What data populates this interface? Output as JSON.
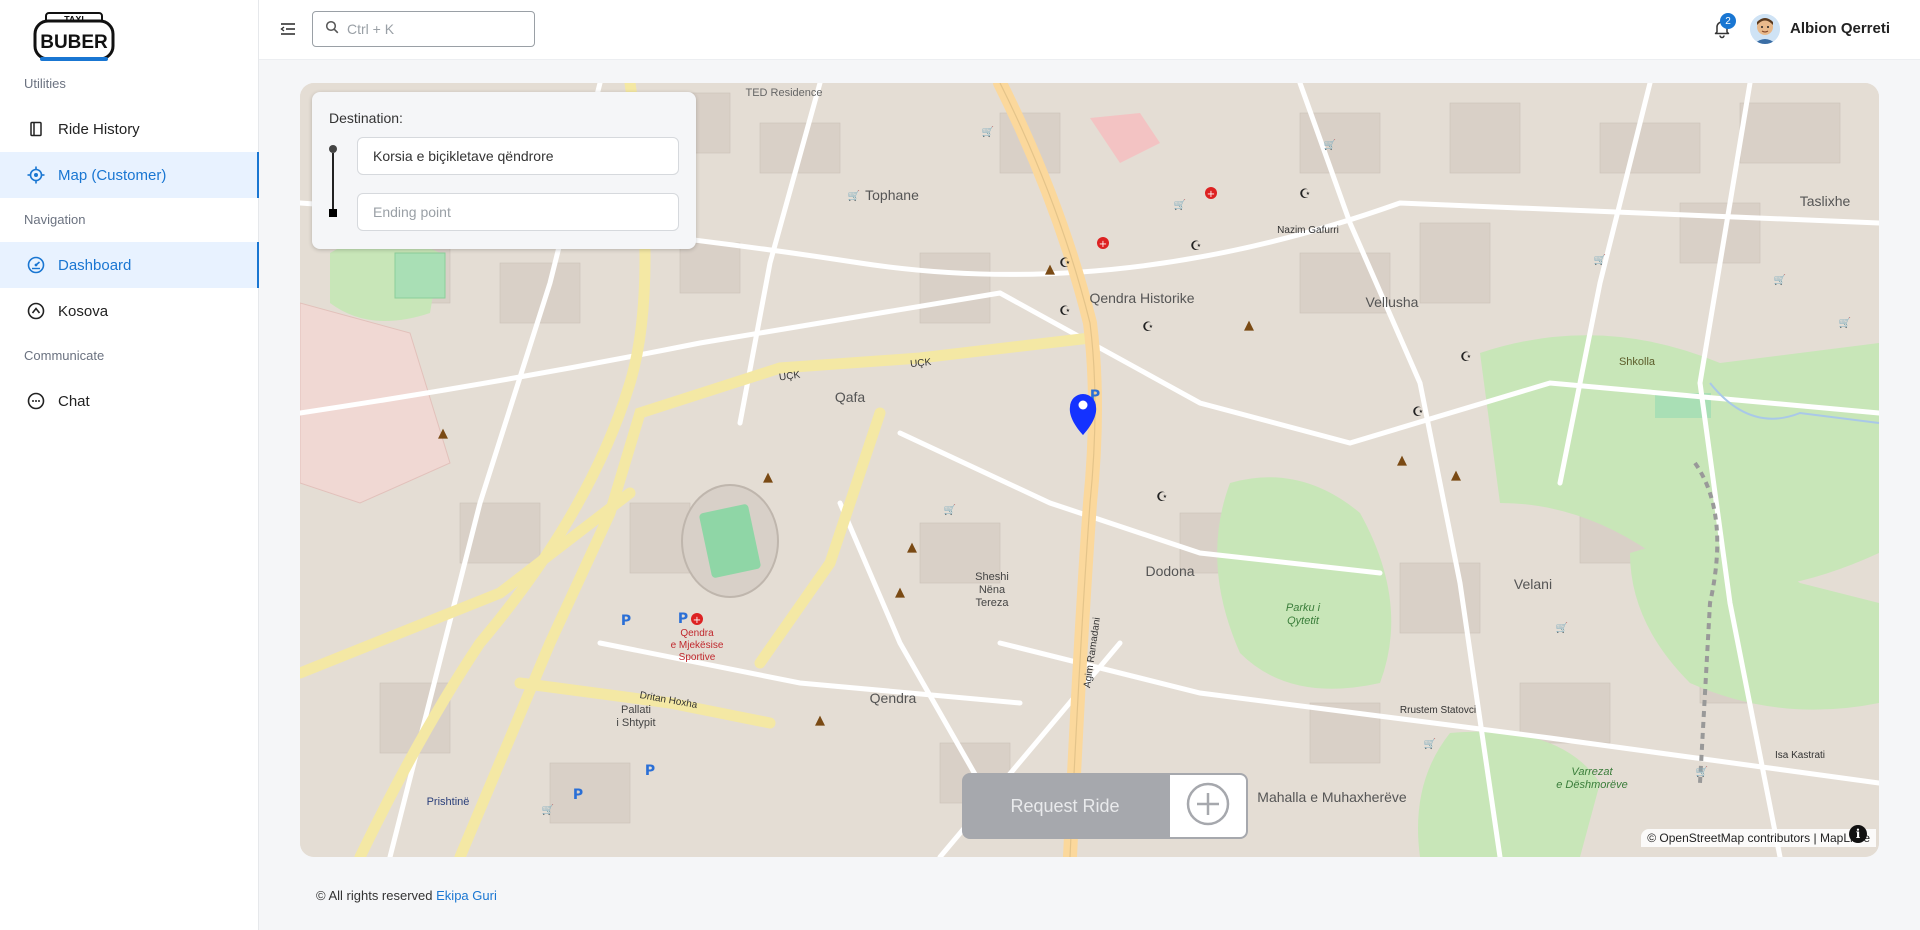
{
  "app": {
    "logo_top": "TAXI",
    "logo_main": "BUBER"
  },
  "sidebar": {
    "groups": [
      {
        "label": "Utilities"
      },
      {
        "label": "Navigation"
      },
      {
        "label": "Communicate"
      }
    ],
    "items": [
      {
        "label": "Ride History",
        "icon": "book-icon",
        "active": false
      },
      {
        "label": "Map (Customer)",
        "icon": "locate-icon",
        "active": true
      },
      {
        "label": "Dashboard",
        "icon": "dashboard-icon",
        "active": true
      },
      {
        "label": "Kosova",
        "icon": "compass-icon",
        "active": false
      },
      {
        "label": "Chat",
        "icon": "chat-icon",
        "active": false
      }
    ]
  },
  "header": {
    "search_placeholder": "Ctrl + K",
    "notification_count": "2",
    "user_name": "Albion Qerreti"
  },
  "map": {
    "destination_title": "Destination:",
    "start_value": "Korsia e biçikletave qëndrore",
    "end_placeholder": "Ending point",
    "request_button": "Request Ride",
    "attribution_osm": "© OpenStreetMap contributors",
    "attribution_sep": "|",
    "attribution_lib": "MapLibre",
    "info_label": "i",
    "labels": {
      "tophane": "Tophane",
      "qendra_historike": "Qendra Historike",
      "vellusha": "Vellusha",
      "taslixhe": "Taslixhe",
      "qafa": "Qafa",
      "dodona": "Dodona",
      "velani": "Velani",
      "qendra": "Qendra",
      "pallati_l1": "Pallati",
      "pallati_l2": "i Shtypit",
      "mahalla": "Mahalla e Muhaxherëve",
      "prishtine": "Prishtinë",
      "sheshi_l1": "Sheshi",
      "sheshi_l2": "Nëna",
      "sheshi_l3": "Tereza",
      "parku_l1": "Parku i",
      "parku_l2": "Qytetit",
      "mjekesise_l1": "Qendra",
      "mjekesise_l2": "e Mjekësise",
      "mjekesise_l3": "Sportive",
      "varrezat_l1": "Varrezat",
      "varrezat_l2": "e Dëshmorëve",
      "ted": "TED Residence",
      "shkolla": "Shkolla",
      "road_uck1": "UÇK",
      "road_uck2": "UÇK",
      "road_agim": "Agim Ramadani",
      "road_dritan": "Dritan Hoxha",
      "road_nazim": "Nazim Gafurri",
      "road_isa": "Isa Kastrati",
      "road_rrustem": "Rrustem Statovci"
    }
  },
  "footer": {
    "text": "© All rights reserved",
    "link": "Ekipa Guri"
  }
}
